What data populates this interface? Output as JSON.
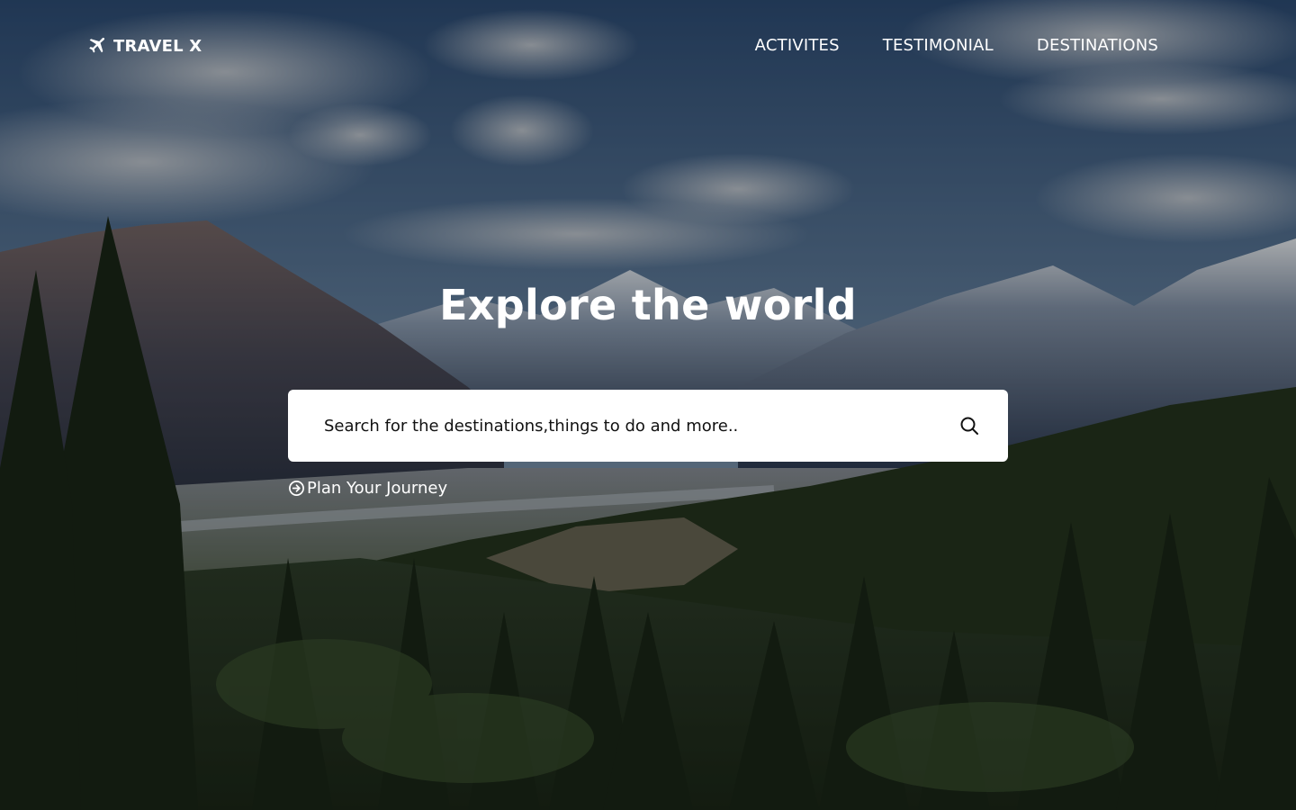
{
  "brand": {
    "name": "TRAVEL X",
    "icon": "airplane-icon"
  },
  "nav": {
    "items": [
      {
        "label": "ACTIVITES"
      },
      {
        "label": "TESTIMONIAL"
      },
      {
        "label": "DESTINATIONS"
      }
    ]
  },
  "hero": {
    "headline": "Explore the world",
    "background_image": "mountain-forest-landscape"
  },
  "search": {
    "placeholder": "Search for the destinations,things to do and more..",
    "value": "",
    "icon": "search-icon"
  },
  "cta": {
    "label": "Plan Your Journey",
    "icon": "circle-arrow-right-icon"
  },
  "colors": {
    "text": "#ffffff",
    "search_bg": "#ffffff",
    "search_text": "#111111"
  }
}
